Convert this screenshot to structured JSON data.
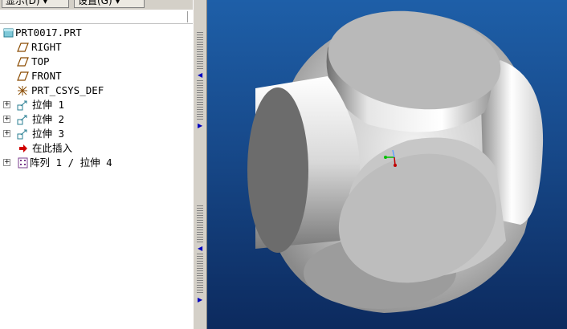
{
  "toolbar": {
    "display_label": "显示(D) ▾",
    "settings_label": "设置(G) ▾"
  },
  "tree": {
    "items": [
      {
        "label": "PRT0017.PRT",
        "icon": "part-icon",
        "expandable": false
      },
      {
        "label": "RIGHT",
        "icon": "datum-plane-icon",
        "expandable": false
      },
      {
        "label": "TOP",
        "icon": "datum-plane-icon",
        "expandable": false
      },
      {
        "label": "FRONT",
        "icon": "datum-plane-icon",
        "expandable": false
      },
      {
        "label": "PRT_CSYS_DEF",
        "icon": "coordinate-system-icon",
        "expandable": false
      },
      {
        "label": "拉伸 1",
        "icon": "extrude-icon",
        "expandable": true
      },
      {
        "label": "拉伸 2",
        "icon": "extrude-icon",
        "expandable": true
      },
      {
        "label": "拉伸 3",
        "icon": "extrude-icon",
        "expandable": true
      },
      {
        "label": "在此插入",
        "icon": "insert-here-arrow-icon",
        "expandable": false
      },
      {
        "label": "阵列 1 / 拉伸 4",
        "icon": "pattern-icon",
        "expandable": true
      }
    ]
  },
  "colors": {
    "viewport_top": "#1e5fa8",
    "viewport_bottom": "#0c2a5e",
    "model_gray": "#b4b4b4",
    "insert_arrow": "#d00000"
  }
}
